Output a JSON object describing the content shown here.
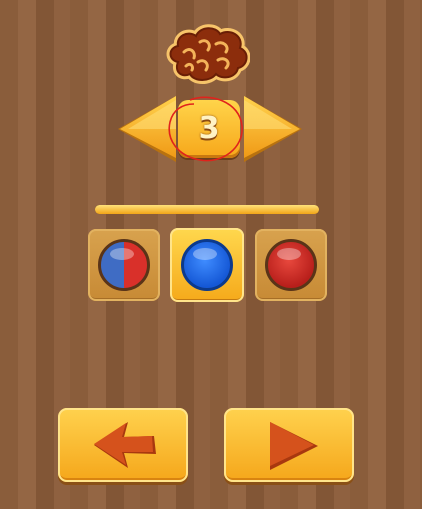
{
  "level": {
    "number": "3",
    "progress_fraction": 1.0
  },
  "icons": {
    "top": "brain-icon",
    "prev": "arrow-left-icon",
    "next": "arrow-right-icon",
    "back": "back-arrow-icon",
    "play": "play-icon"
  },
  "ball_options": [
    {
      "name": "half-blue-half-red",
      "selected": false
    },
    {
      "name": "blue",
      "selected": true
    },
    {
      "name": "red",
      "selected": false
    }
  ],
  "colors": {
    "button_orange": "#f5a61a",
    "arrow_dark": "#c8471a",
    "annotation_red": "#e0231c",
    "ball_blue": "#1558d6",
    "ball_red": "#b81f1b"
  }
}
